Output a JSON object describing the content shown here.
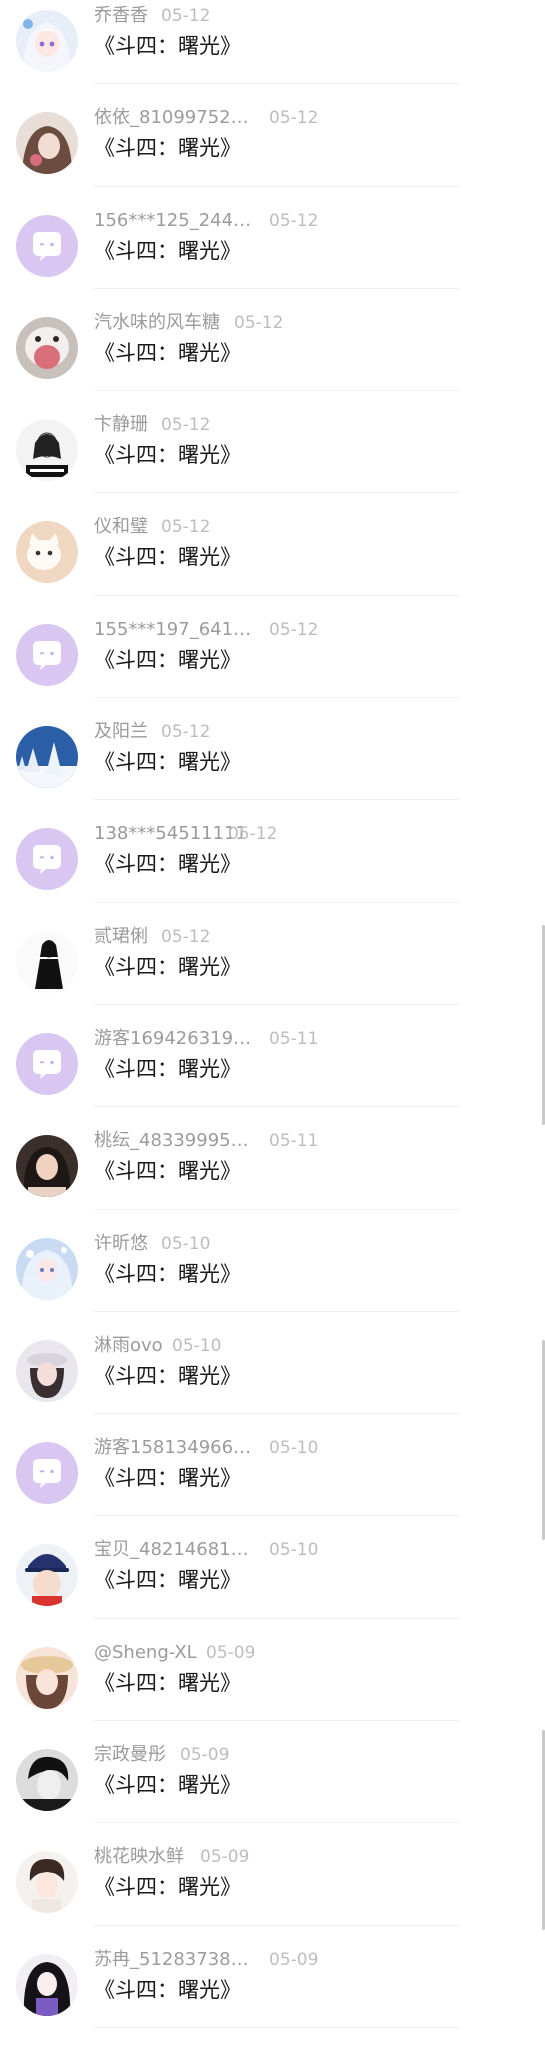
{
  "comments": [
    {
      "user": "乔香香",
      "date": "05-12",
      "text": "《斗四：曙光》",
      "avatar": "anime-girl-avatar"
    },
    {
      "user": "依依_8109975217…",
      "date": "05-12",
      "text": "《斗四：曙光》",
      "avatar": "girl-photo-avatar"
    },
    {
      "user": "156***125_24406…",
      "date": "05-12",
      "text": "《斗四：曙光》",
      "avatar": "default-chat-avatar"
    },
    {
      "user": "汽水味的风车糖",
      "date": "05-12",
      "text": "《斗四：曙光》",
      "avatar": "pet-photo-avatar"
    },
    {
      "user": "卞静珊",
      "date": "05-12",
      "text": "《斗四：曙光》",
      "avatar": "sketch-girl-avatar"
    },
    {
      "user": "仪和璧",
      "date": "05-12",
      "text": "《斗四：曙光》",
      "avatar": "kitten-photo-avatar"
    },
    {
      "user": "155***197_64130…",
      "date": "05-12",
      "text": "《斗四：曙光》",
      "avatar": "default-chat-avatar"
    },
    {
      "user": "及阳兰",
      "date": "05-12",
      "text": "《斗四：曙光》",
      "avatar": "snow-forest-avatar"
    },
    {
      "user": "138***54511111",
      "date": "05-12",
      "text": "《斗四：曙光》",
      "avatar": "default-chat-avatar"
    },
    {
      "user": "贰珺俐",
      "date": "05-12",
      "text": "《斗四：曙光》",
      "avatar": "sketch-figure-avatar"
    },
    {
      "user": "游客16942631901…",
      "date": "05-11",
      "text": "《斗四：曙光》",
      "avatar": "default-chat-avatar"
    },
    {
      "user": "桃纭_483399950…",
      "date": "05-11",
      "text": "《斗四：曙光》",
      "avatar": "girl-portrait-avatar"
    },
    {
      "user": "许昕悠",
      "date": "05-10",
      "text": "《斗四：曙光》",
      "avatar": "anime-fairy-avatar"
    },
    {
      "user": "淋雨ovo",
      "date": "05-10",
      "text": "《斗四：曙光》",
      "avatar": "girl-hat-avatar"
    },
    {
      "user": "游客1581349660…",
      "date": "05-10",
      "text": "《斗四：曙光》",
      "avatar": "default-chat-avatar"
    },
    {
      "user": "宝贝_4821468135…",
      "date": "05-10",
      "text": "《斗四：曙光》",
      "avatar": "baby-hat-avatar"
    },
    {
      "user": "@Sheng-XL",
      "date": "05-09",
      "text": "《斗四：曙光》",
      "avatar": "girl-sunhat-avatar"
    },
    {
      "user": "宗政曼彤",
      "date": "05-09",
      "text": "《斗四：曙光》",
      "avatar": "monochrome-boy-avatar"
    },
    {
      "user": "桃花映水鲜",
      "date": "05-09",
      "text": "《斗四：曙光》",
      "avatar": "anime-boy-avatar"
    },
    {
      "user": "苏冉_5128373823…",
      "date": "05-09",
      "text": "《斗四：曙光》",
      "avatar": "anime-dark-hair-avatar"
    }
  ],
  "colors": {
    "default_avatar_bg": "#d9c7f2",
    "username": "#9b9b9b",
    "date": "#bdbdbd",
    "content": "#1a1a1a"
  }
}
